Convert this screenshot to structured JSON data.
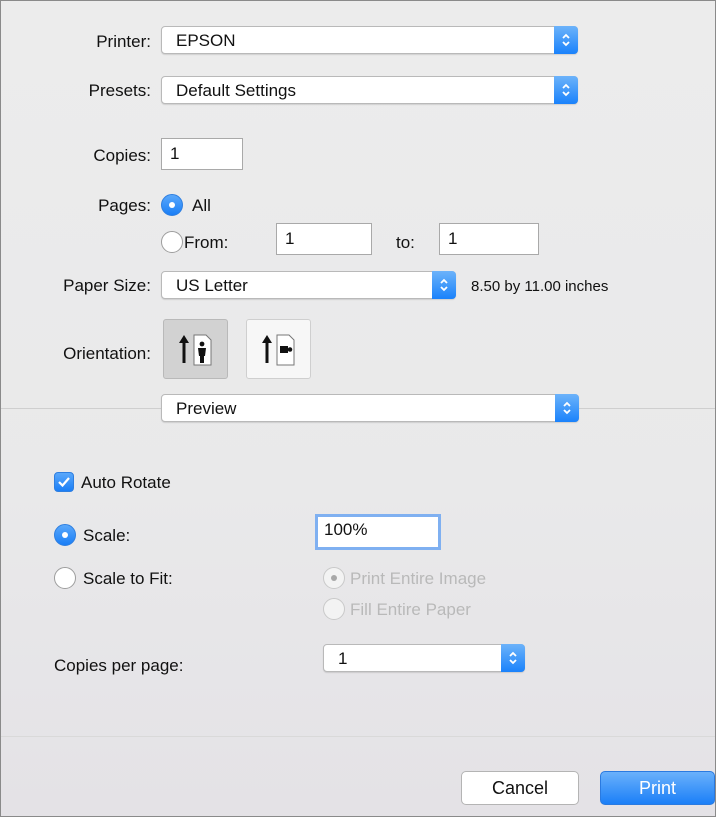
{
  "printer": {
    "label": "Printer:",
    "value": "EPSON"
  },
  "presets": {
    "label": "Presets:",
    "value": "Default Settings"
  },
  "copies": {
    "label": "Copies:",
    "value": "1"
  },
  "pages": {
    "label": "Pages:",
    "all_label": "All",
    "from_label": "From:",
    "from_value": "1",
    "to_label": "to:",
    "to_value": "1",
    "selected": "All"
  },
  "paper_size": {
    "label": "Paper Size:",
    "value": "US Letter",
    "dimensions": "8.50 by 11.00 inches"
  },
  "orientation": {
    "label": "Orientation:",
    "selected": "portrait"
  },
  "section_popup": {
    "value": "Preview"
  },
  "preview": {
    "auto_rotate_label": "Auto Rotate",
    "auto_rotate_checked": true,
    "scale_label": "Scale:",
    "scale_value": "100%",
    "scale_to_fit_label": "Scale to Fit:",
    "print_entire_image_label": "Print Entire Image",
    "fill_entire_paper_label": "Fill Entire Paper",
    "copies_per_page_label": "Copies per page:",
    "copies_per_page_value": "1"
  },
  "buttons": {
    "cancel": "Cancel",
    "print": "Print"
  },
  "colors": {
    "accent": "#1a82fb",
    "focus_ring": "#7fb0f1",
    "disabled_text": "#b9b9b9"
  }
}
